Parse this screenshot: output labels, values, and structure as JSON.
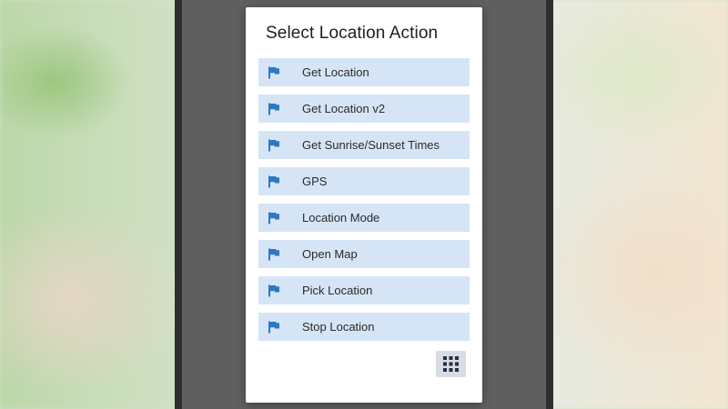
{
  "dialog": {
    "title": "Select Location Action",
    "items": [
      {
        "label": "Get Location",
        "icon": "flag-icon"
      },
      {
        "label": "Get Location v2",
        "icon": "flag-icon"
      },
      {
        "label": "Get Sunrise/Sunset Times",
        "icon": "flag-icon"
      },
      {
        "label": "GPS",
        "icon": "flag-icon"
      },
      {
        "label": "Location Mode",
        "icon": "flag-icon"
      },
      {
        "label": "Open Map",
        "icon": "flag-icon"
      },
      {
        "label": "Pick Location",
        "icon": "flag-icon"
      },
      {
        "label": "Stop Location",
        "icon": "flag-icon"
      }
    ],
    "grid_button_icon": "grid-icon"
  },
  "colors": {
    "item_background": "#d6e5f6",
    "icon_blue": "#2e78c2",
    "dialog_background": "#ffffff",
    "overlay": "#5f5f5f"
  }
}
